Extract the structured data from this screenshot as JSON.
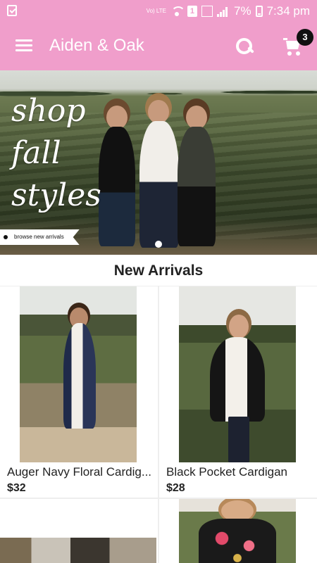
{
  "status_bar": {
    "volte_label": "Vo) LTE",
    "sim_label": "1",
    "battery_percent": "7%",
    "time": "7:34 pm",
    "icons": [
      "checkbox-icon",
      "wifi-icon",
      "signal-icon",
      "battery-icon"
    ]
  },
  "app_bar": {
    "title": "Aiden & Oak",
    "cart_count": "3",
    "icons": [
      "menu-icon",
      "search-icon",
      "cart-icon"
    ]
  },
  "hero": {
    "script_lines": [
      "shop",
      "fall",
      "styles"
    ],
    "cta_label": "browse new arrivals"
  },
  "section": {
    "title": "New Arrivals"
  },
  "products": [
    {
      "name": "Auger Navy Floral Cardig...",
      "price": "$32"
    },
    {
      "name": "Black Pocket Cardigan",
      "price": "$28"
    }
  ],
  "colors": {
    "brand_pink": "#f09ecb",
    "badge_black": "#111111"
  }
}
